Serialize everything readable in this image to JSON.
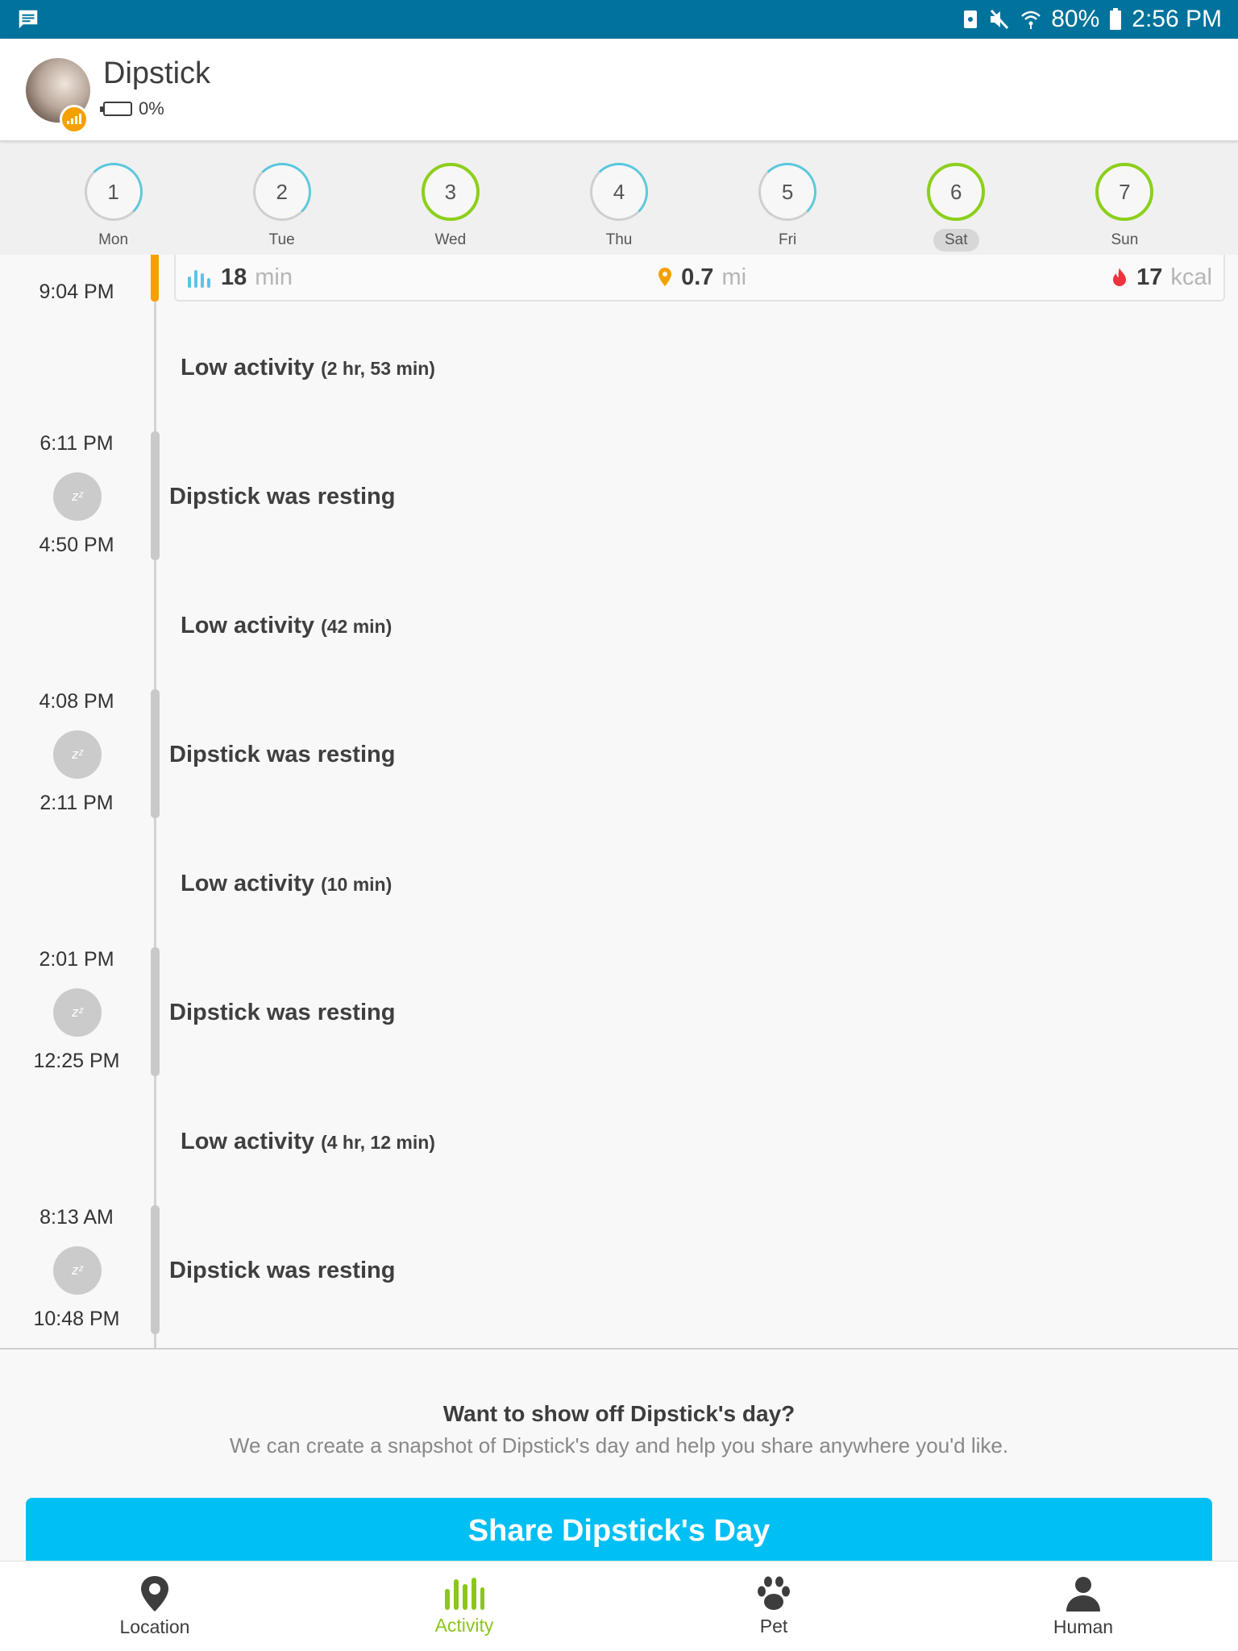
{
  "status_bar": {
    "battery": "80%",
    "time": "2:56 PM"
  },
  "pet": {
    "name": "Dipstick",
    "battery": "0%"
  },
  "week": [
    {
      "num": "1",
      "day": "Mon",
      "state": "partial"
    },
    {
      "num": "2",
      "day": "Tue",
      "state": "partial"
    },
    {
      "num": "3",
      "day": "Wed",
      "state": "done"
    },
    {
      "num": "4",
      "day": "Thu",
      "state": "partial"
    },
    {
      "num": "5",
      "day": "Fri",
      "state": "partial"
    },
    {
      "num": "6",
      "day": "Sat",
      "state": "done",
      "selected": true
    },
    {
      "num": "7",
      "day": "Sun",
      "state": "done"
    }
  ],
  "summary": {
    "time": "9:04 PM",
    "active_value": "18",
    "active_unit": "min",
    "distance_value": "0.7",
    "distance_unit": "mi",
    "calories_value": "17",
    "calories_unit": "kcal"
  },
  "timeline": {
    "low_activity_label": "Low activity",
    "resting_text": "Dipstick was resting",
    "low": [
      {
        "duration": "(2 hr, 53 min)"
      },
      {
        "duration": "(42 min)"
      },
      {
        "duration": "(10 min)"
      },
      {
        "duration": "(4 hr, 12 min)"
      }
    ],
    "rest": [
      {
        "end": "6:11 PM",
        "start": "4:50 PM"
      },
      {
        "end": "4:08 PM",
        "start": "2:11 PM"
      },
      {
        "end": "2:01 PM",
        "start": "12:25 PM"
      },
      {
        "end": "8:13 AM",
        "start": "10:48 PM"
      }
    ]
  },
  "share": {
    "title": "Want to show off Dipstick's day?",
    "subtitle": "We can create a snapshot of Dipstick's day and help you share anywhere you'd like.",
    "button": "Share Dipstick's Day"
  },
  "nav": [
    {
      "label": "Location",
      "icon": "location-pin-icon"
    },
    {
      "label": "Activity",
      "icon": "activity-bars-icon",
      "active": true
    },
    {
      "label": "Pet",
      "icon": "paw-icon"
    },
    {
      "label": "Human",
      "icon": "person-icon"
    }
  ],
  "colors": {
    "status_bar": "#00729b",
    "accent_orange": "#f5a000",
    "accent_green": "#8cc61a",
    "accent_blue": "#00bff3"
  }
}
